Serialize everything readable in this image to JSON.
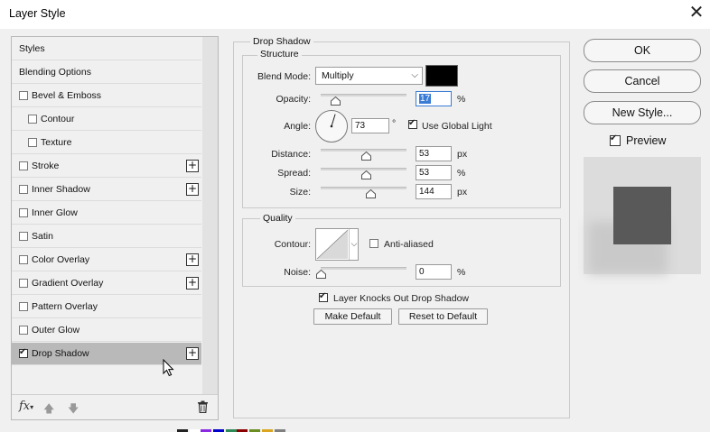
{
  "window": {
    "title": "Layer Style",
    "close_glyph": "✕"
  },
  "styles_panel": {
    "items": [
      {
        "label": "Styles",
        "checkbox": false,
        "checked": false,
        "indent": false,
        "plus": false,
        "selected": false
      },
      {
        "label": "Blending Options",
        "checkbox": false,
        "checked": false,
        "indent": false,
        "plus": false,
        "selected": false
      },
      {
        "label": "Bevel & Emboss",
        "checkbox": true,
        "checked": false,
        "indent": false,
        "plus": false,
        "selected": false
      },
      {
        "label": "Contour",
        "checkbox": true,
        "checked": false,
        "indent": true,
        "plus": false,
        "selected": false
      },
      {
        "label": "Texture",
        "checkbox": true,
        "checked": false,
        "indent": true,
        "plus": false,
        "selected": false
      },
      {
        "label": "Stroke",
        "checkbox": true,
        "checked": false,
        "indent": false,
        "plus": true,
        "selected": false
      },
      {
        "label": "Inner Shadow",
        "checkbox": true,
        "checked": false,
        "indent": false,
        "plus": true,
        "selected": false
      },
      {
        "label": "Inner Glow",
        "checkbox": true,
        "checked": false,
        "indent": false,
        "plus": false,
        "selected": false
      },
      {
        "label": "Satin",
        "checkbox": true,
        "checked": false,
        "indent": false,
        "plus": false,
        "selected": false
      },
      {
        "label": "Color Overlay",
        "checkbox": true,
        "checked": false,
        "indent": false,
        "plus": true,
        "selected": false
      },
      {
        "label": "Gradient Overlay",
        "checkbox": true,
        "checked": false,
        "indent": false,
        "plus": true,
        "selected": false
      },
      {
        "label": "Pattern Overlay",
        "checkbox": true,
        "checked": false,
        "indent": false,
        "plus": false,
        "selected": false
      },
      {
        "label": "Outer Glow",
        "checkbox": true,
        "checked": false,
        "indent": false,
        "plus": false,
        "selected": false
      },
      {
        "label": "Drop Shadow",
        "checkbox": true,
        "checked": true,
        "indent": false,
        "plus": true,
        "selected": true
      }
    ],
    "plus_glyph": "+",
    "fx_label": "fx",
    "up_glyph": "🡅",
    "down_glyph": "🡇"
  },
  "drop_shadow": {
    "group_title": "Drop Shadow",
    "structure": {
      "title": "Structure",
      "blend_mode_label": "Blend Mode:",
      "blend_mode_value": "Multiply",
      "shadow_color": "#000000",
      "opacity_label": "Opacity:",
      "opacity_value": "17",
      "opacity_unit": "%",
      "opacity_fraction": 0.17,
      "angle_label": "Angle:",
      "angle_value": "73",
      "angle_degrees": 73,
      "angle_unit": "°",
      "use_global_light_label": "Use Global Light",
      "use_global_light": true,
      "distance_label": "Distance:",
      "distance_value": "53",
      "distance_unit": "px",
      "distance_fraction": 0.53,
      "spread_label": "Spread:",
      "spread_value": "53",
      "spread_unit": "%",
      "spread_fraction": 0.53,
      "size_label": "Size:",
      "size_value": "144",
      "size_unit": "px",
      "size_fraction": 0.58
    },
    "quality": {
      "title": "Quality",
      "contour_label": "Contour:",
      "anti_aliased_label": "Anti-aliased",
      "anti_aliased": false,
      "noise_label": "Noise:",
      "noise_value": "0",
      "noise_unit": "%",
      "noise_fraction": 0
    },
    "knockout_label": "Layer Knocks Out Drop Shadow",
    "knockout": true,
    "make_default_label": "Make Default",
    "reset_default_label": "Reset to Default"
  },
  "side_buttons": {
    "ok_label": "OK",
    "cancel_label": "Cancel",
    "new_style_label": "New Style...",
    "preview_label": "Preview",
    "preview_checked": true
  },
  "colors": {
    "selected_row": "#b9b9b9",
    "focus_blue": "#3a7bd5",
    "preview_square": "#595959"
  }
}
